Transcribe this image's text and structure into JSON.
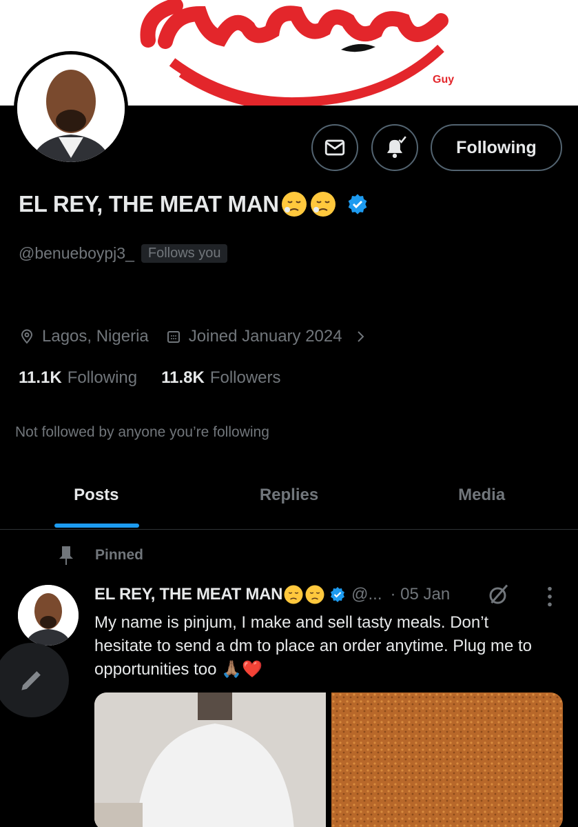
{
  "banner": {
    "brand_script": "Culinary",
    "brand_sub": "Guy"
  },
  "profile": {
    "display_name": "EL REY, THE MEAT MAN",
    "handle": "@benueboypj3_",
    "follows_you": "Follows you",
    "location": "Lagos, Nigeria",
    "joined": "Joined January 2024",
    "following_count": "11.1K",
    "following_label": "Following",
    "followers_count": "11.8K",
    "followers_label": "Followers",
    "not_followed": "Not followed by anyone you’re following"
  },
  "actions": {
    "follow_state": "Following"
  },
  "tabs": [
    {
      "label": "Posts",
      "active": true
    },
    {
      "label": "Replies",
      "active": false
    },
    {
      "label": "Media",
      "active": false
    }
  ],
  "post": {
    "pinned_label": "Pinned",
    "author_name": "EL REY, THE MEAT MAN",
    "author_handle": "@...",
    "date": "· 05 Jan",
    "text": "My name is pinjum, I make and sell tasty meals. Don’t hesitate to send a dm to place an order anytime. Plug me to opportunities too 🙏🏽❤️"
  },
  "colors": {
    "accent": "#1d9bf0",
    "muted": "#71767b",
    "text": "#e7e9ea",
    "border": "#536471",
    "brand_red": "#e3262b"
  },
  "icons": [
    "mail-icon",
    "bell-icon",
    "verified-badge-icon",
    "location-icon",
    "calendar-icon",
    "chevron-right-icon",
    "pin-icon",
    "more-icon",
    "grok-icon",
    "compose-icon"
  ]
}
